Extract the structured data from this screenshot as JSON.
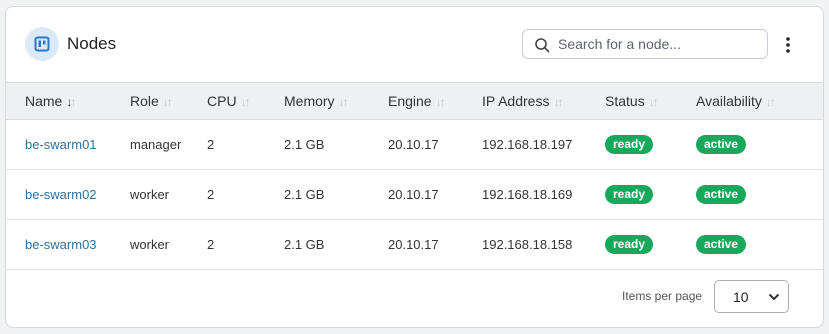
{
  "panel": {
    "title": "Nodes",
    "icon": "docker-node-icon",
    "search_placeholder": "Search for a node...",
    "menu_icon": "more-vertical-icon"
  },
  "table": {
    "columns": [
      {
        "label": "Name",
        "sort": "desc"
      },
      {
        "label": "Role",
        "sort": "none"
      },
      {
        "label": "CPU",
        "sort": "none"
      },
      {
        "label": "Memory",
        "sort": "none"
      },
      {
        "label": "Engine",
        "sort": "none"
      },
      {
        "label": "IP Address",
        "sort": "none"
      },
      {
        "label": "Status",
        "sort": "none"
      },
      {
        "label": "Availability",
        "sort": "none"
      }
    ],
    "rows": [
      {
        "name": "be-swarm01",
        "role": "manager",
        "cpu": "2",
        "memory": "2.1 GB",
        "engine": "20.10.17",
        "ip": "192.168.18.197",
        "status": "ready",
        "availability": "active"
      },
      {
        "name": "be-swarm02",
        "role": "worker",
        "cpu": "2",
        "memory": "2.1 GB",
        "engine": "20.10.17",
        "ip": "192.168.18.169",
        "status": "ready",
        "availability": "active"
      },
      {
        "name": "be-swarm03",
        "role": "worker",
        "cpu": "2",
        "memory": "2.1 GB",
        "engine": "20.10.17",
        "ip": "192.168.18.158",
        "status": "ready",
        "availability": "active"
      }
    ]
  },
  "pagination": {
    "items_per_page_label": "Items per page",
    "items_per_page_value": "10"
  },
  "colors": {
    "link": "#2f6f9f",
    "badge_green": "#17a85c",
    "header_bg": "#eef0f3",
    "icon_bg": "#dceaf8",
    "icon_fg": "#2b78c5"
  }
}
